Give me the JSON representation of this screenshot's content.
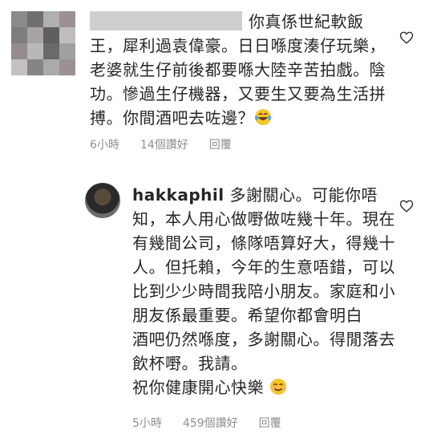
{
  "comment1": {
    "text": "你真係世紀軟飯王，犀利過袁偉豪。日日喺度湊仔玩樂，老婆就生仔前後都要喺大陸辛苦拍戲。陰功。慘過生仔機器，又要生又要為生活拼搏。你間酒吧去咗邊？",
    "emoji": "laughing-tears",
    "time": "6小時",
    "likes": "14個讚好",
    "reply": "回覆"
  },
  "comment2": {
    "username": "hakkaphil",
    "text": " 多謝關心。可能你唔知，本人用心做嘢做咗幾十年。現在有幾間公司，條隊唔算好大，得幾十人。但托賴，今年的生意唔錯，可以比到少少時間我陪小朋友。家庭和小朋友係最重要。希望你都會明白\n酒吧仍然喺度，多謝關心。得閒落去飲杯嘢。我請。\n祝你健康開心快樂",
    "emoji": "smiling-face",
    "time": "5小時",
    "likes": "459個讚好",
    "reply": "回覆"
  },
  "colors": {
    "text": "#262626",
    "meta": "#8e8e8e",
    "background": "#ffffff"
  }
}
